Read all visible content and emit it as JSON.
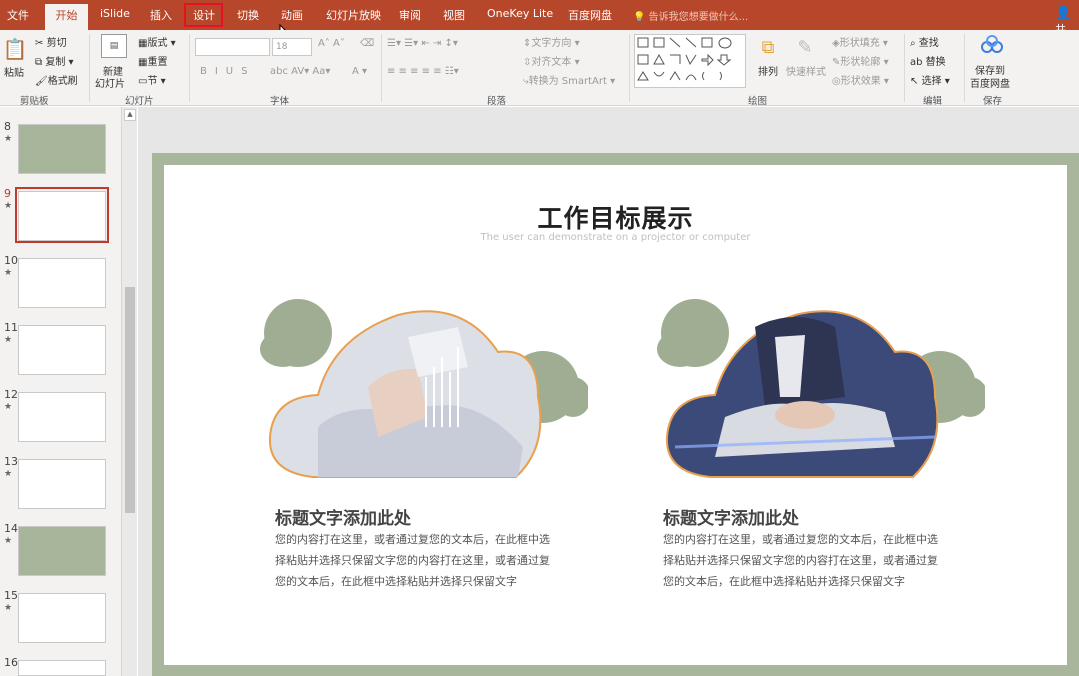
{
  "tabs": [
    "文件",
    "开始",
    "iSlide",
    "插入",
    "设计",
    "切换",
    "动画",
    "幻灯片放映",
    "审阅",
    "视图",
    "OneKey Lite",
    "百度网盘"
  ],
  "tell_me": "告诉我您想要做什么...",
  "user_label": "共",
  "ribbon": {
    "clipboard": {
      "paste": "粘贴",
      "cut": "剪切",
      "copy": "复制",
      "format_painter": "格式刷",
      "label": "剪贴板"
    },
    "slides": {
      "new_slide": "新建",
      "new_slide2": "幻灯片",
      "layout": "版式",
      "reset": "重置",
      "section": "节",
      "label": "幻灯片"
    },
    "font": {
      "size": "18",
      "label": "字体"
    },
    "paragraph": {
      "text_direction": "文字方向",
      "align_text": "对齐文本",
      "smartart": "转换为 SmartArt",
      "label": "段落"
    },
    "drawing": {
      "arrange": "排列",
      "quick_styles": "快速样式",
      "shape_fill": "形状填充",
      "shape_outline": "形状轮廓",
      "shape_effects": "形状效果",
      "label": "绘图"
    },
    "editing": {
      "find": "查找",
      "replace": "替换",
      "select": "选择",
      "label": "编辑"
    },
    "save": {
      "save_to": "保存到",
      "baidu": "百度网盘",
      "label": "保存"
    }
  },
  "thumbnails": [
    {
      "num": "8",
      "star": "★",
      "style": "green"
    },
    {
      "num": "9",
      "star": "★",
      "style": "selected"
    },
    {
      "num": "10",
      "star": "★",
      "style": "white"
    },
    {
      "num": "11",
      "star": "★",
      "style": "white"
    },
    {
      "num": "12",
      "star": "★",
      "style": "white"
    },
    {
      "num": "13",
      "star": "★",
      "style": "white"
    },
    {
      "num": "14",
      "star": "★",
      "style": "green"
    },
    {
      "num": "15",
      "star": "★",
      "style": "white"
    },
    {
      "num": "16",
      "star": "",
      "style": "white"
    }
  ],
  "slide": {
    "title": "工作目标展示",
    "subtitle": "The user can demonstrate on a projector or computer",
    "left": {
      "heading": "标题文字添加此处",
      "lines": [
        "您的内容打在这里，或者通过复您的文本后，在此框中选",
        "择粘贴并选择只保留文字您的内容打在这里，或者通过复",
        "您的文本后，在此框中选择粘贴并选择只保留文字"
      ]
    },
    "right": {
      "heading": "标题文字添加此处",
      "lines": [
        "您的内容打在这里，或者通过复您的文本后，在此框中选",
        "择粘贴并选择只保留文字您的内容打在这里，或者通过复",
        "您的文本后，在此框中选择粘贴并选择只保留文字"
      ]
    }
  },
  "colors": {
    "accent": "#b7472a",
    "slide_frame": "#a8b79b",
    "cloud": "#9fae92",
    "outline": "#e8a04f",
    "selected_thumb": "#c0392b"
  }
}
